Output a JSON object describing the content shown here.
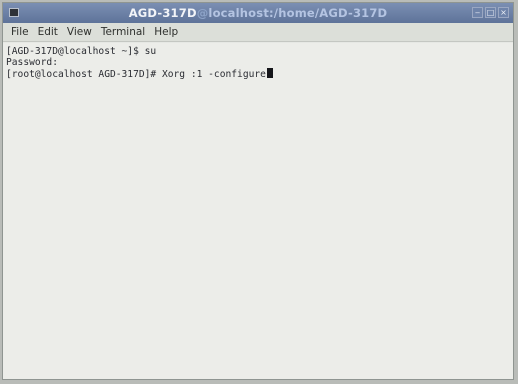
{
  "window": {
    "title_user": "AGD-317D",
    "title_at": "@",
    "title_host_path": "localhost:/home/AGD-317D"
  },
  "menubar": {
    "items": [
      "File",
      "Edit",
      "View",
      "Terminal",
      "Help"
    ]
  },
  "terminal": {
    "lines": [
      "[AGD-317D@localhost ~]$ su",
      "Password:",
      "[root@localhost AGD-317D]# Xorg :1 -configure"
    ]
  },
  "colors": {
    "titlebar": "#6a7fa6",
    "terminal_bg": "#ecede9",
    "terminal_text": "#2b2d33"
  },
  "icons": {
    "window_menu": "terminal-window-icon",
    "controls": [
      "minimize-icon",
      "maximize-icon",
      "close-icon"
    ]
  }
}
